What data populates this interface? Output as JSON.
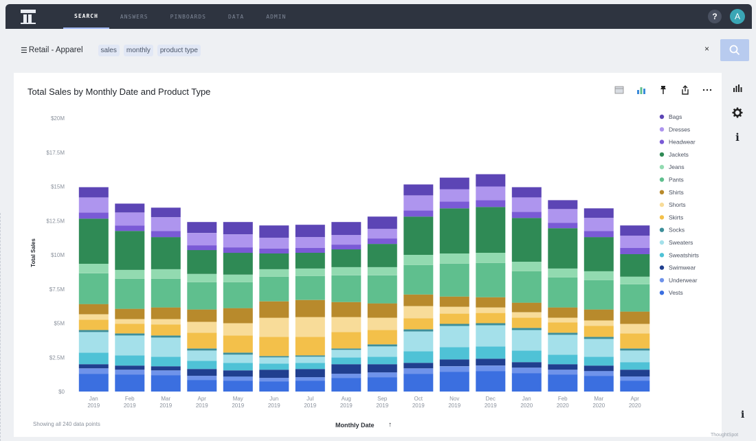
{
  "nav": {
    "tabs": [
      "SEARCH",
      "ANSWERS",
      "PINBOARDS",
      "DATA",
      "ADMIN"
    ],
    "help_label": "?",
    "avatar_label": "A"
  },
  "search": {
    "source_label": "Retail - Apparel",
    "tokens": [
      "sales",
      "monthly",
      "product type"
    ],
    "clear_label": "×"
  },
  "chart_card": {
    "footer_note": "Showing all 240 data points",
    "sort_label": "Monthly Date",
    "sort_arrow": "↑"
  },
  "rail": {
    "info_label": "i"
  },
  "bottom_info_label": "i",
  "watermark": "ThoughtSpot",
  "colors": {
    "accent": "#9fb6f2",
    "nav_bg": "#2e3440",
    "search_button": "#b8cbef"
  },
  "chart_data": {
    "type": "bar",
    "stacked": true,
    "title": "Total Sales by Monthly Date and Product Type",
    "xlabel": "Monthly Date",
    "ylabel": "Total Sales",
    "ylim": [
      0,
      20000000
    ],
    "yticks": [
      "$0",
      "$2.5M",
      "$5M",
      "$7.5M",
      "$10M",
      "$12.5M",
      "$15M",
      "$17.5M",
      "$20M"
    ],
    "grid": false,
    "legend_position": "right",
    "categories": [
      [
        "Jan",
        "2019"
      ],
      [
        "Feb",
        "2019"
      ],
      [
        "Mar",
        "2019"
      ],
      [
        "Apr",
        "2019"
      ],
      [
        "May",
        "2019"
      ],
      [
        "Jun",
        "2019"
      ],
      [
        "Jul",
        "2019"
      ],
      [
        "Aug",
        "2019"
      ],
      [
        "Sep",
        "2019"
      ],
      [
        "Oct",
        "2019"
      ],
      [
        "Nov",
        "2019"
      ],
      [
        "Dec",
        "2019"
      ],
      [
        "Jan",
        "2020"
      ],
      [
        "Feb",
        "2020"
      ],
      [
        "Mar",
        "2020"
      ],
      [
        "Apr",
        "2020"
      ]
    ],
    "series": [
      {
        "name": "Vests",
        "color": "#3b6fe0",
        "values": [
          1.3,
          1.25,
          1.2,
          0.85,
          0.8,
          0.75,
          0.8,
          1.0,
          1.05,
          1.3,
          1.45,
          1.5,
          1.35,
          1.25,
          1.15,
          0.8
        ]
      },
      {
        "name": "Underwear",
        "color": "#6f93ea",
        "values": [
          0.4,
          0.35,
          0.35,
          0.3,
          0.3,
          0.25,
          0.25,
          0.3,
          0.35,
          0.4,
          0.4,
          0.4,
          0.4,
          0.35,
          0.35,
          0.3
        ]
      },
      {
        "name": "Swimwear",
        "color": "#203f8f",
        "values": [
          0.3,
          0.3,
          0.3,
          0.5,
          0.45,
          0.6,
          0.6,
          0.7,
          0.6,
          0.4,
          0.5,
          0.5,
          0.4,
          0.4,
          0.4,
          0.5
        ]
      },
      {
        "name": "Sweatshirts",
        "color": "#4fc2d6",
        "values": [
          0.85,
          0.75,
          0.7,
          0.6,
          0.55,
          0.45,
          0.45,
          0.5,
          0.55,
          0.85,
          0.9,
          0.9,
          0.85,
          0.7,
          0.65,
          0.55
        ]
      },
      {
        "name": "Sweaters",
        "color": "#a4e0ea",
        "values": [
          1.5,
          1.45,
          1.4,
          0.75,
          0.6,
          0.45,
          0.45,
          0.55,
          0.75,
          1.45,
          1.55,
          1.55,
          1.5,
          1.45,
          1.3,
          0.85
        ]
      },
      {
        "name": "Socks",
        "color": "#3e8f9a",
        "values": [
          0.15,
          0.15,
          0.15,
          0.15,
          0.15,
          0.1,
          0.1,
          0.1,
          0.15,
          0.15,
          0.15,
          0.15,
          0.15,
          0.15,
          0.15,
          0.15
        ]
      },
      {
        "name": "Skirts",
        "color": "#f3c04a",
        "values": [
          0.75,
          0.7,
          0.8,
          1.15,
          1.25,
          1.4,
          1.35,
          1.2,
          1.05,
          0.8,
          0.75,
          0.75,
          0.75,
          0.75,
          0.8,
          1.1
        ]
      },
      {
        "name": "Shorts",
        "color": "#f8dc99",
        "values": [
          0.4,
          0.35,
          0.4,
          0.8,
          0.9,
          1.4,
          1.45,
          1.1,
          0.9,
          0.9,
          0.5,
          0.4,
          0.4,
          0.35,
          0.4,
          0.7
        ]
      },
      {
        "name": "Shirts",
        "color": "#b88a2c",
        "values": [
          0.75,
          0.75,
          0.85,
          0.9,
          1.1,
          1.2,
          1.25,
          1.1,
          1.05,
          0.85,
          0.75,
          0.75,
          0.7,
          0.75,
          0.8,
          0.9
        ]
      },
      {
        "name": "Pants",
        "color": "#5fbf8e",
        "values": [
          2.25,
          2.2,
          2.1,
          2.0,
          1.9,
          1.8,
          1.75,
          1.95,
          2.05,
          2.15,
          2.4,
          2.5,
          2.3,
          2.2,
          2.15,
          2.0
        ]
      },
      {
        "name": "Jeans",
        "color": "#92dab0",
        "values": [
          0.7,
          0.65,
          0.7,
          0.6,
          0.55,
          0.55,
          0.55,
          0.6,
          0.6,
          0.75,
          0.75,
          0.75,
          0.7,
          0.65,
          0.65,
          0.55
        ]
      },
      {
        "name": "Jackets",
        "color": "#2f8a55",
        "values": [
          3.3,
          2.85,
          2.35,
          1.75,
          1.6,
          1.15,
          1.15,
          1.3,
          1.7,
          2.8,
          3.3,
          3.35,
          3.2,
          2.95,
          2.5,
          1.65
        ]
      },
      {
        "name": "Headwear",
        "color": "#7a5ad6",
        "values": [
          0.45,
          0.4,
          0.45,
          0.35,
          0.4,
          0.35,
          0.35,
          0.35,
          0.4,
          0.45,
          0.5,
          0.5,
          0.45,
          0.4,
          0.45,
          0.45
        ]
      },
      {
        "name": "Dresses",
        "color": "#ae95ee",
        "values": [
          1.1,
          0.95,
          1.0,
          0.9,
          0.95,
          0.8,
          0.8,
          0.7,
          0.7,
          1.1,
          0.9,
          1.0,
          1.05,
          1.0,
          0.95,
          0.9
        ]
      },
      {
        "name": "Bags",
        "color": "#5c45b5",
        "values": [
          0.75,
          0.65,
          0.7,
          0.8,
          0.9,
          0.9,
          0.9,
          0.95,
          0.9,
          0.8,
          0.85,
          0.9,
          0.75,
          0.65,
          0.7,
          0.75
        ]
      }
    ]
  }
}
